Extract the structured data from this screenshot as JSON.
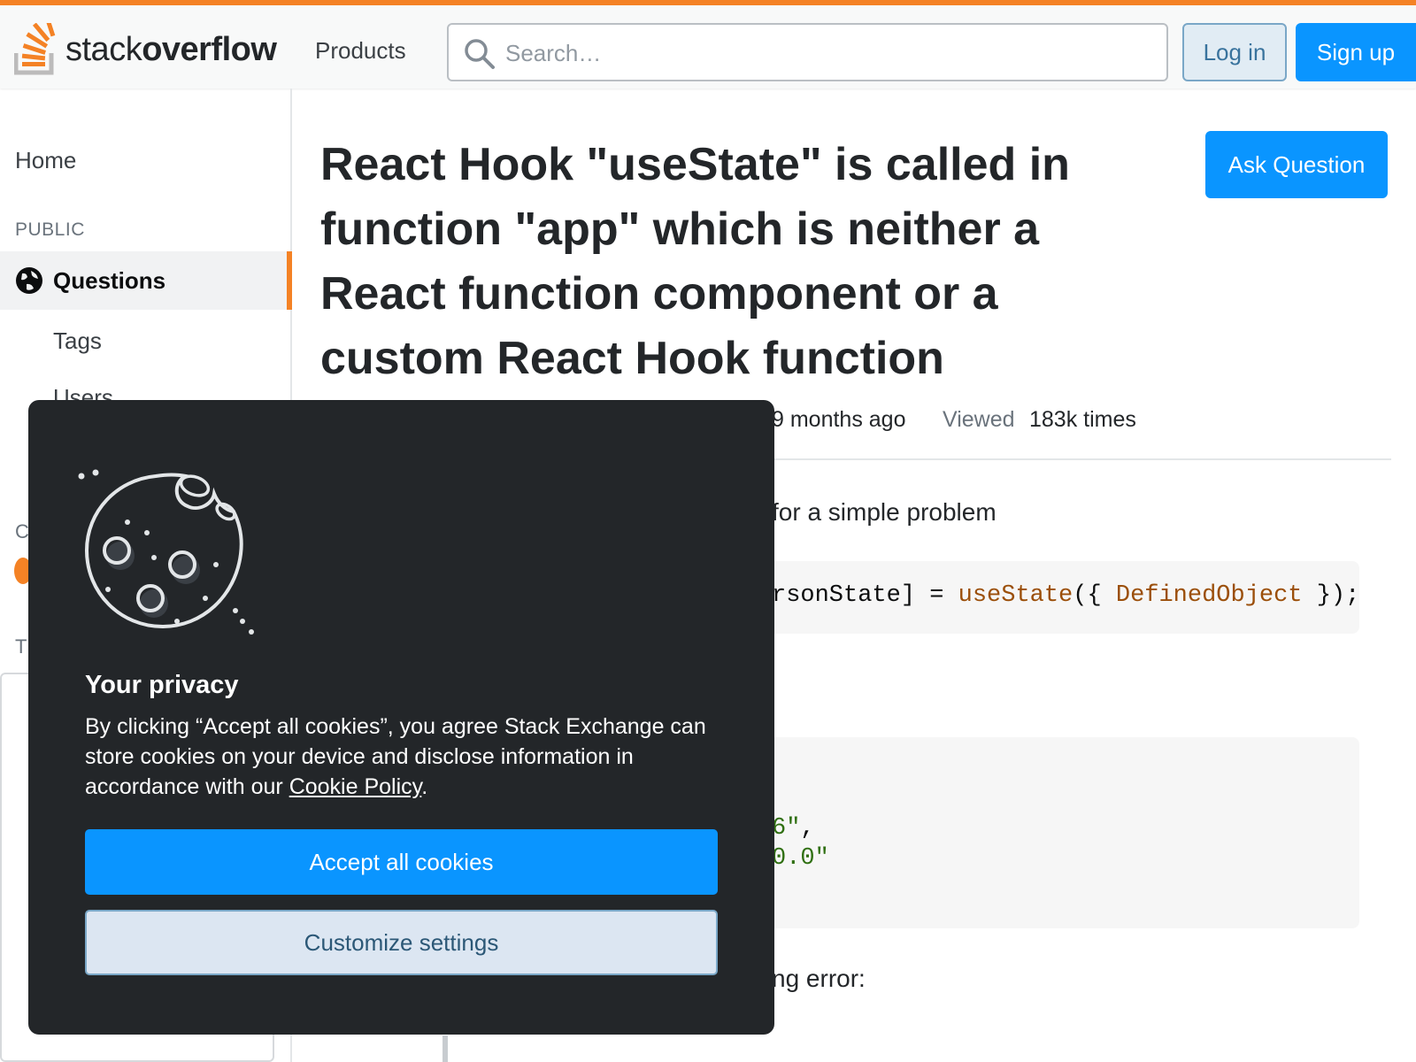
{
  "header": {
    "logo_light": "stack",
    "logo_bold": "overflow",
    "products_label": "Products",
    "search_placeholder": "Search…",
    "login_label": "Log in",
    "signup_label": "Sign up",
    "accent_color": "#f48225",
    "primary_color": "#0a95ff"
  },
  "sidebar": {
    "home_label": "Home",
    "public_label": "PUBLIC",
    "questions_label": "Questions",
    "tags_label": "Tags",
    "users_label": "Users",
    "partial_c": "C",
    "partial_t": "T"
  },
  "question": {
    "title": "React Hook \"useState\" is called in function \"app\" which is neither a React function component or a custom React Hook function",
    "ask_label": "Ask Question",
    "asked_text": "9 months ago",
    "viewed_label": "Viewed",
    "viewed_value": "183k times",
    "body_fragment": "for a simple problem",
    "code1": {
      "pre": "rsonState] = ",
      "fn": "useState",
      "mid": "({ ",
      "id": "DefinedObject",
      "post": " });"
    },
    "code2": {
      "line1_str": "6\"",
      "line1_punct": ",",
      "line2_str": "0.0\""
    },
    "body_fragment2": "ng error:"
  },
  "cookie": {
    "title": "Your privacy",
    "desc_before": "By clicking “Accept all cookies”, you agree Stack Exchange can store cookies on your device and disclose information in accordance with our ",
    "policy_link": "Cookie Policy",
    "desc_after": ".",
    "accept_label": "Accept all cookies",
    "customize_label": "Customize settings"
  }
}
